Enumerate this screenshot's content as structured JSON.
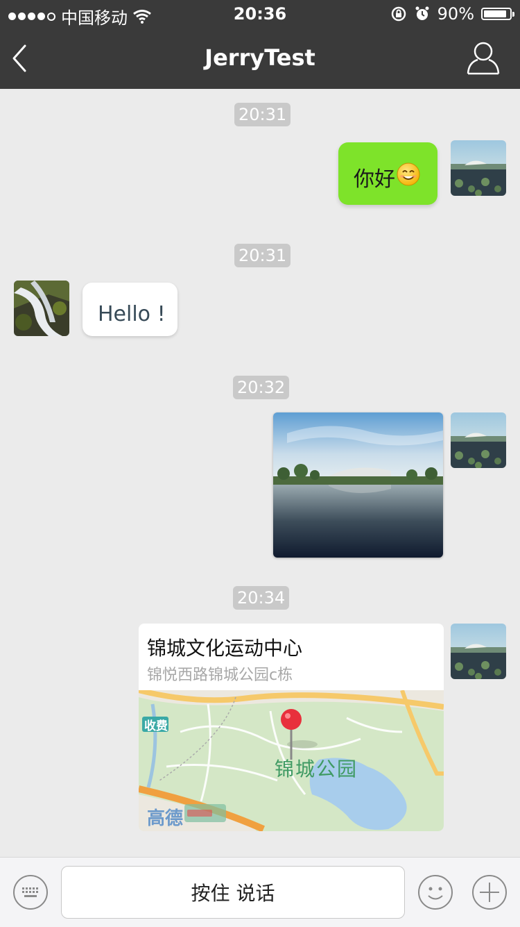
{
  "status_bar": {
    "carrier": "中国移动",
    "time": "20:36",
    "battery_percent": "90%",
    "battery_level": 0.9
  },
  "nav": {
    "title": "JerryTest"
  },
  "messages": [
    {
      "type": "timestamp",
      "text": "20:31"
    },
    {
      "type": "text",
      "side": "right",
      "text": "你好",
      "emoji": "smile-emoji"
    },
    {
      "type": "timestamp",
      "text": "20:31"
    },
    {
      "type": "text",
      "side": "left",
      "text": "Hello !"
    },
    {
      "type": "timestamp",
      "text": "20:32"
    },
    {
      "type": "image",
      "side": "right"
    },
    {
      "type": "timestamp",
      "text": "20:34"
    },
    {
      "type": "location",
      "side": "right",
      "title": "锦城文化运动中心",
      "address": "锦悦西路锦城公园c栋",
      "map_label": "锦城公园",
      "map_badge": "收费",
      "map_logo": "高德"
    }
  ],
  "input_bar": {
    "talk_label": "按住 说话"
  },
  "icons": {
    "back": "chevron-left-icon",
    "profile": "user-icon",
    "keyboard": "keyboard-icon",
    "emoji": "smiley-icon",
    "more": "plus-icon"
  },
  "colors": {
    "nav_bg": "#3a3a3a",
    "chat_bg": "#ebebeb",
    "sent_bubble": "#7ee32a",
    "received_bubble": "#ffffff"
  }
}
